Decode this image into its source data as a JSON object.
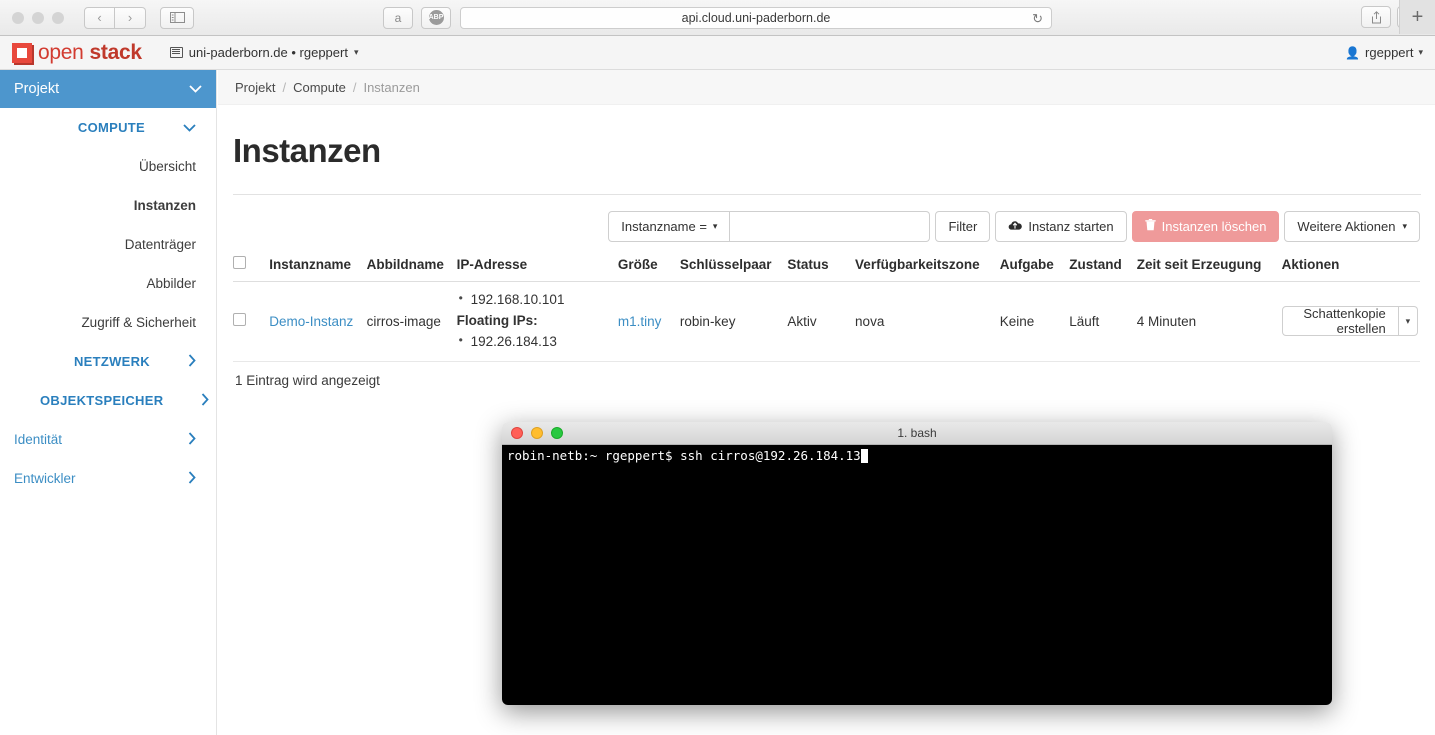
{
  "browser": {
    "url": "api.cloud.uni-paderborn.de",
    "back_label": "‹",
    "forward_label": "›",
    "reload_label": "↻",
    "amazon_label": "a",
    "adblock_label": "ABP",
    "share_label": "⇧",
    "tabs_label": "⧉",
    "newtab_label": "+"
  },
  "openstack": {
    "logo_open": "open",
    "logo_stack": "stack",
    "project_switcher": "uni-paderborn.de • rgeppert",
    "project_switcher_caret": "▾",
    "user": "rgeppert",
    "user_caret": "▾"
  },
  "sidebar": {
    "header": {
      "label": "Projekt",
      "chevron": "⌄"
    },
    "items": [
      {
        "label": "COMPUTE",
        "type": "group",
        "chevron": "⌄",
        "name": "sidebar-group-compute"
      },
      {
        "label": "Übersicht",
        "type": "sub",
        "name": "sidebar-item-uebersicht"
      },
      {
        "label": "Instanzen",
        "type": "sub-active",
        "name": "sidebar-item-instanzen"
      },
      {
        "label": "Datenträger",
        "type": "sub",
        "name": "sidebar-item-datentraeger"
      },
      {
        "label": "Abbilder",
        "type": "sub",
        "name": "sidebar-item-abbilder"
      },
      {
        "label": "Zugriff & Sicherheit",
        "type": "sub",
        "name": "sidebar-item-zugriff-sicherheit"
      },
      {
        "label": "NETZWERK",
        "type": "group",
        "chevron": "›",
        "name": "sidebar-group-netzwerk"
      },
      {
        "label": "OBJEKTSPEICHER",
        "type": "group",
        "chevron": "›",
        "name": "sidebar-group-objektspeicher"
      },
      {
        "label": "Identität",
        "type": "top",
        "chevron": "›",
        "name": "sidebar-item-identitaet"
      },
      {
        "label": "Entwickler",
        "type": "top",
        "chevron": "›",
        "name": "sidebar-item-entwickler"
      }
    ]
  },
  "breadcrumb": {
    "item1": "Projekt",
    "item2": "Compute",
    "current": "Instanzen",
    "sep": "/"
  },
  "page": {
    "title": "Instanzen",
    "count_text": "1 Eintrag wird angezeigt"
  },
  "toolbar": {
    "filter_select": "Instanzname =",
    "filter_select_caret": "▾",
    "filter_input_value": "",
    "filter_input_placeholder": "",
    "filter_button": "Filter",
    "launch_button": "Instanz starten",
    "launch_icon": "☁",
    "delete_button": "Instanzen löschen",
    "delete_icon": "🗑",
    "more_button": "Weitere Aktionen",
    "more_caret": "▾"
  },
  "table": {
    "headers": [
      "Instanzname",
      "Abbildname",
      "IP-Adresse",
      "Größe",
      "Schlüsselpaar",
      "Status",
      "Verfügbarkeitszone",
      "Aufgabe",
      "Zustand",
      "Zeit seit Erzeugung",
      "Aktionen"
    ],
    "rows": [
      {
        "instance_name": "Demo-Instanz",
        "image_name": "cirros-image",
        "ip_primary": "192.168.10.101",
        "ip_floating_label": "Floating IPs:",
        "ip_floating": "192.26.184.13",
        "flavor": "m1.tiny",
        "keypair": "robin-key",
        "status": "Aktiv",
        "zone": "nova",
        "task": "Keine",
        "power_state": "Läuft",
        "uptime": "4 Minuten",
        "action_label": "Schattenkopie erstellen",
        "action_caret": "▾"
      }
    ]
  },
  "terminal": {
    "title": "1. bash",
    "line": "robin-netb:~ rgeppert$ ssh cirros@192.26.184.13"
  },
  "colors": {
    "accent_blue": "#3c8ec4",
    "sidebar_header_blue": "#4d96cd",
    "danger_pink": "#ef9a9a",
    "openstack_red": "#d23b30"
  }
}
